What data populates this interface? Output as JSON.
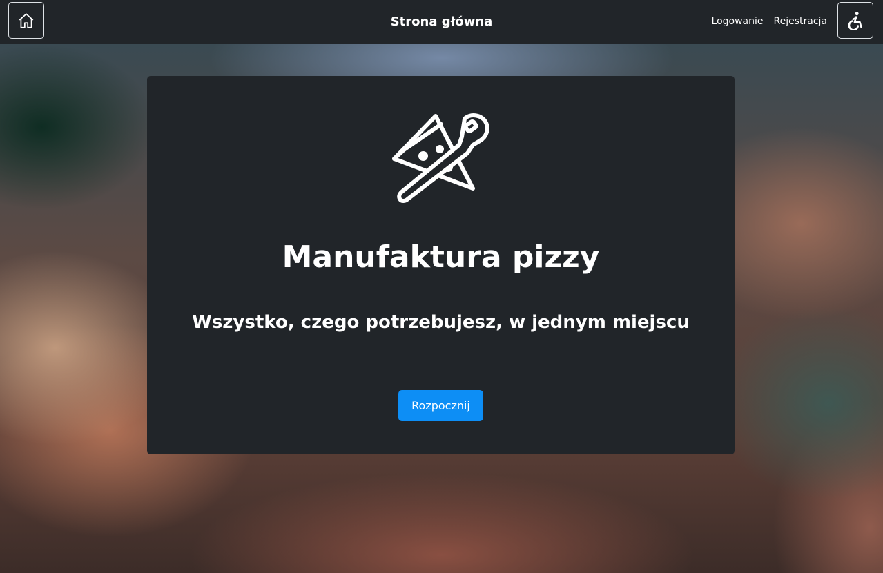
{
  "nav": {
    "title": "Strona główna",
    "links": {
      "login": "Logowanie",
      "register": "Rejestracja"
    },
    "home_icon": "home-icon",
    "accessibility_icon": "wheelchair-icon"
  },
  "hero": {
    "logo_icon": "pizza-slice-peel-icon",
    "title": "Manufaktura pizzy",
    "subtitle": "Wszystko, czego potrzebujesz, w jednym miejscu",
    "start_label": "Rozpocznij"
  },
  "colors": {
    "navbar_bg": "#212529",
    "card_bg": "#212529",
    "primary_button": "#0d8ef5",
    "text": "#ffffff"
  }
}
